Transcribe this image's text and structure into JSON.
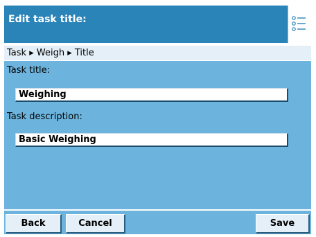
{
  "header": {
    "title": "Edit task title:",
    "menu_icon": "list-icon"
  },
  "breadcrumb": {
    "items": [
      "Task",
      "Weigh",
      "Title"
    ],
    "separator": "▸"
  },
  "form": {
    "task_title": {
      "label": "Task title:",
      "value": "Weighing"
    },
    "task_description": {
      "label": "Task description:",
      "value": "Basic Weighing"
    }
  },
  "footer": {
    "back_label": "Back",
    "cancel_label": "Cancel",
    "save_label": "Save"
  },
  "colors": {
    "header": "#2b84b8",
    "content": "#6cb4de",
    "breadcrumb_bg": "#e4eff7"
  }
}
